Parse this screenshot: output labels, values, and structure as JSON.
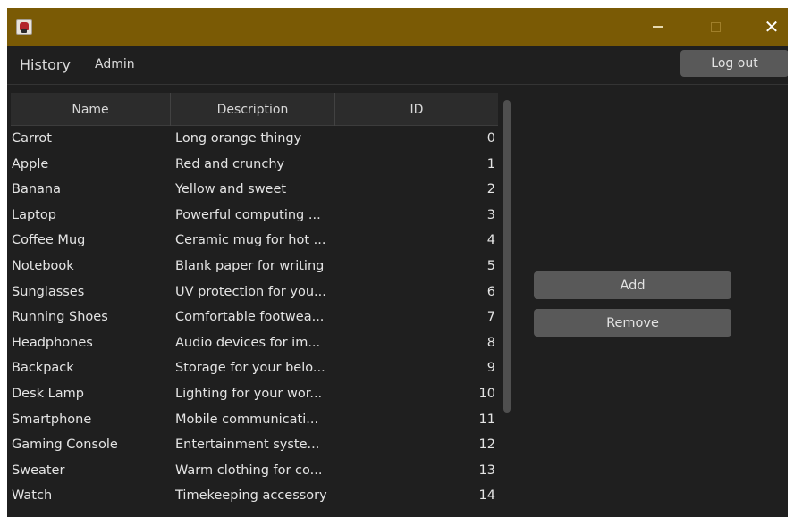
{
  "window": {
    "app_icon": "app-logo-icon",
    "controls": {
      "minimize_icon": "minimize-icon",
      "maximize_icon": "maximize-icon",
      "close_icon": "close-icon",
      "close_glyph": "✕"
    },
    "titlebar_color": "#7a5a05"
  },
  "menu": {
    "history_label": "History",
    "admin_label": "Admin",
    "logout_label": "Log out"
  },
  "table": {
    "headers": {
      "name": "Name",
      "description": "Description",
      "id": "ID"
    },
    "rows": [
      {
        "name": "Carrot",
        "description": "Long orange thingy",
        "id": "0"
      },
      {
        "name": "Apple",
        "description": "Red and crunchy",
        "id": "1"
      },
      {
        "name": "Banana",
        "description": "Yellow and sweet",
        "id": "2"
      },
      {
        "name": "Laptop",
        "description": "Powerful computing ...",
        "id": "3"
      },
      {
        "name": "Coffee Mug",
        "description": "Ceramic mug for hot ...",
        "id": "4"
      },
      {
        "name": "Notebook",
        "description": "Blank paper for writing",
        "id": "5"
      },
      {
        "name": "Sunglasses",
        "description": "UV protection for you...",
        "id": "6"
      },
      {
        "name": "Running Shoes",
        "description": "Comfortable footwea...",
        "id": "7"
      },
      {
        "name": "Headphones",
        "description": "Audio devices for im...",
        "id": "8"
      },
      {
        "name": "Backpack",
        "description": "Storage for your belo...",
        "id": "9"
      },
      {
        "name": "Desk Lamp",
        "description": "Lighting for your wor...",
        "id": "10"
      },
      {
        "name": "Smartphone",
        "description": "Mobile communicati...",
        "id": "11"
      },
      {
        "name": "Gaming Console",
        "description": "Entertainment syste...",
        "id": "12"
      },
      {
        "name": "Sweater",
        "description": "Warm clothing for co...",
        "id": "13"
      },
      {
        "name": "Watch",
        "description": "Timekeeping accessory",
        "id": "14"
      }
    ]
  },
  "actions": {
    "add_label": "Add",
    "remove_label": "Remove"
  }
}
